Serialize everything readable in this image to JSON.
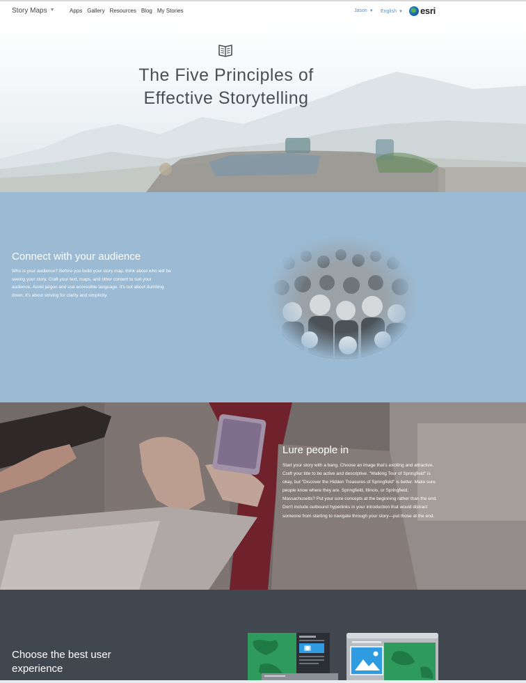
{
  "nav": {
    "brand": "Story Maps",
    "links": [
      "Apps",
      "Gallery",
      "Resources",
      "Blog",
      "My Stories"
    ],
    "user": "Jason",
    "language": "English",
    "logo_text": "esri"
  },
  "hero": {
    "icon": "open-book-icon",
    "title_line1": "The Five Principles of",
    "title_line2": "Effective Storytelling"
  },
  "sections": [
    {
      "heading": "Connect with your audience",
      "body": "Who is your audience? Before you build your story map, think about who will be seeing your story. Craft your text, maps, and other content to suit your audience. Avoid jargon and use accessible language. It's not about dumbing down; it's about striving for clarity and simplicity.",
      "background": "#9bbad3"
    },
    {
      "heading": "Lure people in",
      "body": "Start your story with a bang. Choose an image that's exciting and attractive. Craft your title to be active and descriptive. \"Walking Tour of Springfield\" is okay, but \"Discover the Hidden Treasures of Springfield\" is better. Make sure people know where they are. Springfield, Illinois, or Springfield, Massachusetts? Put your core concepts at the beginning rather than the end. Don't include outbound hyperlinks in your introduction that would distract someone from starting to navigate through your story—put those at the end."
    },
    {
      "heading": "Choose the best user experience",
      "background": "#40474f"
    }
  ],
  "colors": {
    "link_blue": "#5b8fc6",
    "map_green": "#2e9a5c",
    "photo_blue": "#2f9be0"
  }
}
